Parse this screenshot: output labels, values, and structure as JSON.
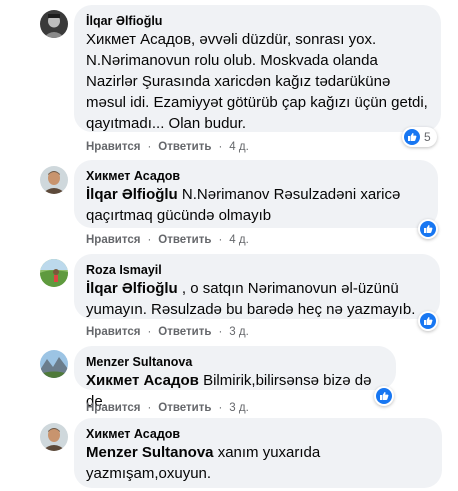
{
  "ui": {
    "like_label": "Нравится",
    "reply_label": "Ответить",
    "colors": {
      "bubble": "#f0f2f5",
      "like_blue": "#1877f2",
      "meta_gray": "#65676b"
    }
  },
  "comments": [
    {
      "author": "İlqar Əlfioğlu",
      "avatar_icon": "profile-photo-bw",
      "mention": "",
      "text": "Хикмет Асадов, əvvəli düzdür, sonrası yox. N.Nərimanovun rolu olub. Moskvada olanda Nazirlər Şurasında xaricdən kağız tədarükünə məsul idi. Ezamiyyət götürüb çap kağızı üçün getdi, qayıtmadı... Olan budur.",
      "time": "4 д.",
      "reaction_count": "5"
    },
    {
      "author": "Хикмет Асадов",
      "avatar_icon": "profile-photo-man",
      "mention": "İlqar Əlfioğlu",
      "text": " N.Nərimanov Rəsulzadəni xaricə qaçırtmaq gücündə olmayıb",
      "time": "4 д.",
      "reaction_count": ""
    },
    {
      "author": "Roza Ismayil",
      "avatar_icon": "profile-photo-landscape",
      "mention": "İlqar Əlfioğlu",
      "text": " , o satqın Nərimanovun əl-üzünü yumayın. Rəsulzadə bu barədə heç nə yazmayıb.",
      "time": "3 д.",
      "reaction_count": ""
    },
    {
      "author": "Menzer Sultanova",
      "avatar_icon": "profile-photo-mountains",
      "mention": "Хикмет Асадов",
      "text": " Bilmirik,bilirsənsə bizə də de.",
      "time": "3 д.",
      "reaction_count": ""
    },
    {
      "author": "Хикмет Асадов",
      "avatar_icon": "profile-photo-man",
      "mention": "Menzer Sultanova",
      "text": " xanım yuxarıda yazmışam,oxuyun.",
      "time": "",
      "reaction_count": ""
    }
  ]
}
